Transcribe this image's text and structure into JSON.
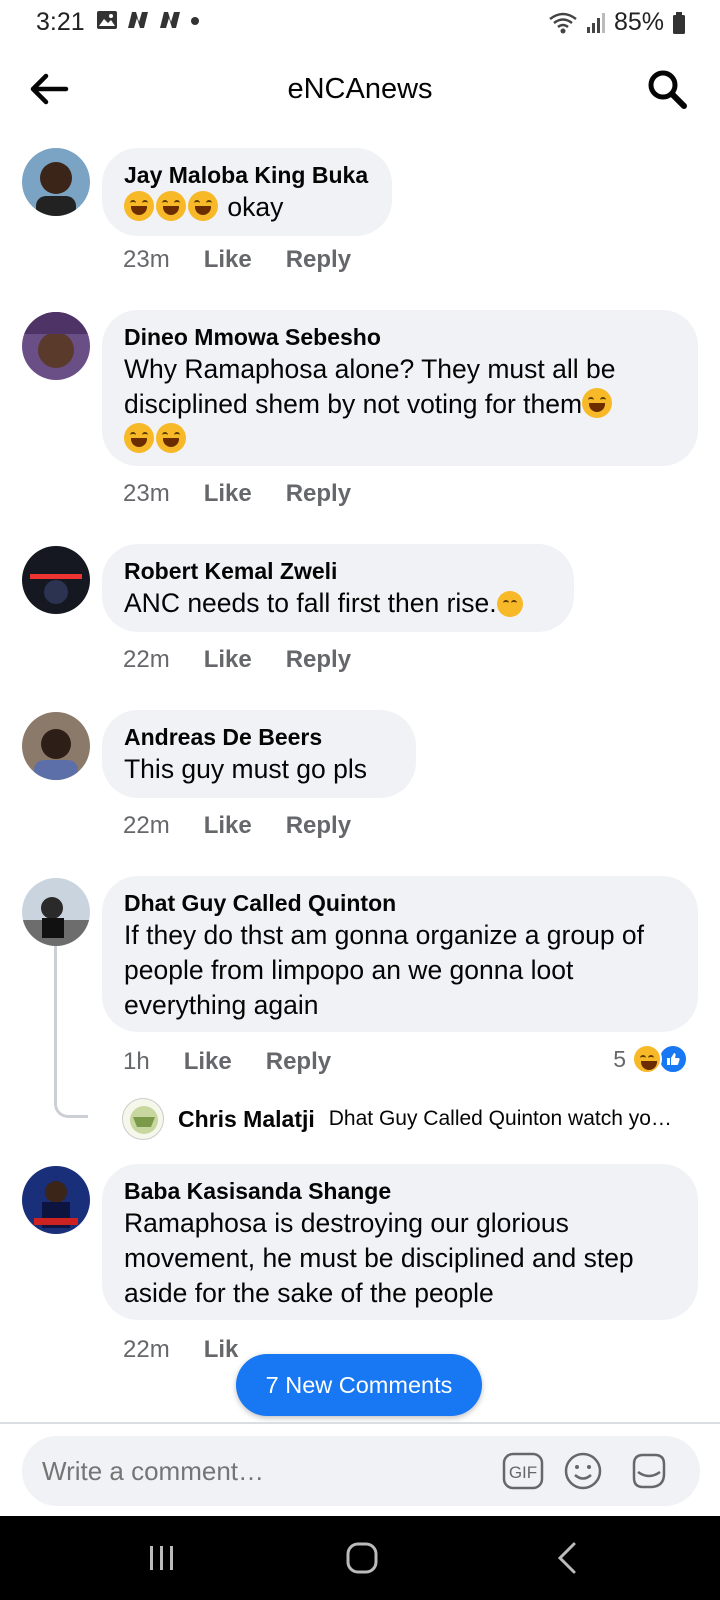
{
  "status_bar": {
    "time": "3:21",
    "battery": "85%"
  },
  "app_bar": {
    "title": "eNCAnews"
  },
  "comments": [
    {
      "name": "Jay Maloba King Buka",
      "text": "okay",
      "emoji_prefix_count": 3,
      "time": "23m",
      "like": "Like",
      "reply": "Reply"
    },
    {
      "name": "Dineo Mmowa Sebesho",
      "text_line1": "Why Ramaphosa alone? They must all be",
      "text_line2": "disciplined shem by not voting for them",
      "time": "23m",
      "like": "Like",
      "reply": "Reply"
    },
    {
      "name": "Robert Kemal Zweli",
      "text": "ANC needs to fall first then rise.",
      "time": "22m",
      "like": "Like",
      "reply": "Reply"
    },
    {
      "name": "Andreas De Beers",
      "text": "This guy must go pls",
      "time": "22m",
      "like": "Like",
      "reply": "Reply"
    },
    {
      "name": "Dhat Guy Called Quinton",
      "text_line1": "If they do thst am gonna organize a group of",
      "text_line2": "people from limpopo an we gonna loot",
      "text_line3": "everything again",
      "time": "1h",
      "like": "Like",
      "reply": "Reply",
      "reaction_count": "5",
      "reply_preview": {
        "name": "Chris Malatji",
        "text": "Dhat Guy Called Quinton watch yo…"
      }
    },
    {
      "name": "Baba Kasisanda Shange",
      "text_line1": "Ramaphosa is destroying our glorious",
      "text_line2": "movement, he must be disciplined and step",
      "text_line3": "aside for the sake of the people",
      "time": "22m",
      "like": "Lik"
    }
  ],
  "new_comments_pill": "7 New Comments",
  "composer": {
    "placeholder": "Write a comment…",
    "gif_label": "GIF"
  },
  "colors": {
    "accent": "#1877f2",
    "bubble": "#f0f2f5",
    "meta_text": "#65676b"
  }
}
